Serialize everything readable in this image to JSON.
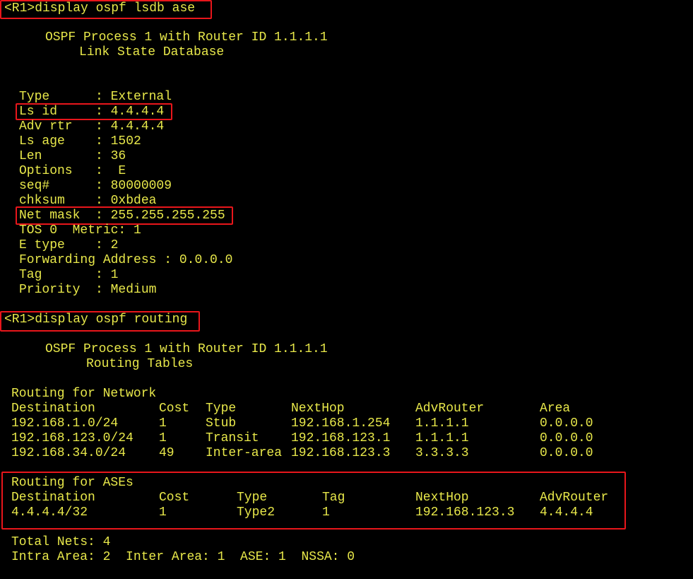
{
  "terminal": {
    "text_color": "#e8e84a",
    "background": "#000000",
    "highlight_color": "#e8161b",
    "cmd1": "<R1>display ospf lsdb ase",
    "lsdb_header1": "OSPF Process 1 with Router ID 1.1.1.1",
    "lsdb_header2": "Link State Database",
    "lsa": {
      "type": "Type      : External",
      "ls_id": "Ls id     : 4.4.4.4",
      "adv_rtr": "Adv rtr   : 4.4.4.4",
      "ls_age": "Ls age    : 1502",
      "len": "Len       : 36",
      "options": "Options   :  E",
      "seq": "seq#      : 80000009",
      "chksum": "chksum    : 0xbdea",
      "net_mask": "Net mask  : 255.255.255.255",
      "tos_metric": "TOS 0  Metric: 1",
      "e_type": "E type    : 2",
      "fwd_addr": "Forwarding Address : 0.0.0.0",
      "tag": "Tag       : 1",
      "priority": "Priority  : Medium"
    },
    "cmd2": "<R1>display ospf routing",
    "routing_header1": "OSPF Process 1 with Router ID 1.1.1.1",
    "routing_header2": "Routing Tables",
    "network": {
      "title": "Routing for Network",
      "columns": [
        "Destination",
        "Cost",
        "Type",
        "NextHop",
        "AdvRouter",
        "Area"
      ],
      "rows": [
        [
          "192.168.1.0/24",
          "1",
          "Stub",
          "192.168.1.254",
          "1.1.1.1",
          "0.0.0.0"
        ],
        [
          "192.168.123.0/24",
          "1",
          "Transit",
          "192.168.123.1",
          "1.1.1.1",
          "0.0.0.0"
        ],
        [
          "192.168.34.0/24",
          "49",
          "Inter-area",
          "192.168.123.3",
          "3.3.3.3",
          "0.0.0.0"
        ]
      ]
    },
    "ase": {
      "title": "Routing for ASEs",
      "columns": [
        "Destination",
        "Cost",
        "Type",
        "Tag",
        "NextHop",
        "AdvRouter"
      ],
      "rows": [
        [
          "4.4.4.4/32",
          "1",
          "Type2",
          "1",
          "192.168.123.3",
          "4.4.4.4"
        ]
      ]
    },
    "totals1": "Total Nets: 4",
    "totals2": "Intra Area: 2  Inter Area: 1  ASE: 1  NSSA: 0"
  }
}
